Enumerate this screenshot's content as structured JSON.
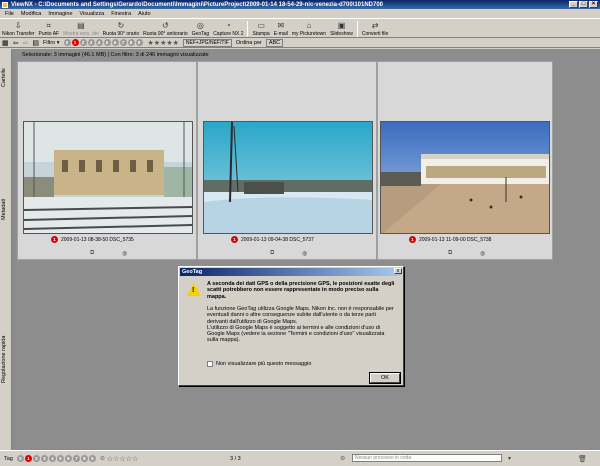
{
  "window": {
    "title": "ViewNX - C:\\Documents and Settings\\Gerardo\\Documenti\\Immagini\\PictureProject\\2009-01-14 18-54-29-nic-venezia-d700\\101ND700"
  },
  "menu": [
    "File",
    "Modifica",
    "Immagine",
    "Visualizza",
    "Finestra",
    "Aiuto"
  ],
  "toolbar": {
    "items": [
      {
        "label": "Nikon Transfer",
        "icon": "transfer-icon",
        "glyph": "⇩"
      },
      {
        "label": "Punto AF",
        "icon": "af-point-icon",
        "glyph": "⌗"
      },
      {
        "label": "Mostra vers. dei",
        "icon": "versions-icon",
        "glyph": "▤",
        "disabled": true
      },
      {
        "label": "Ruota 90° orario",
        "icon": "rotate-cw-icon",
        "glyph": "↻"
      },
      {
        "label": "Ruota 90° antiorario",
        "icon": "rotate-ccw-icon",
        "glyph": "↺"
      },
      {
        "label": "GeoTag",
        "icon": "geotag-icon",
        "glyph": "◎"
      },
      {
        "label": "Capture NX 2",
        "icon": "capture-nx-icon",
        "glyph": "◔"
      },
      {
        "label": "Stampa",
        "icon": "print-icon",
        "glyph": "▭"
      },
      {
        "label": "E-mail",
        "icon": "email-icon",
        "glyph": "✉"
      },
      {
        "label": "my Picturetown",
        "icon": "picturetown-icon",
        "glyph": "⌂"
      },
      {
        "label": "Slideshow",
        "icon": "slideshow-icon",
        "glyph": "▣"
      },
      {
        "label": "Converti file",
        "icon": "convert-icon",
        "glyph": "⇄"
      }
    ]
  },
  "filterbar": {
    "filter_label": "Filtro",
    "label_numbers": [
      "0",
      "1",
      "2",
      "3",
      "4",
      "5",
      "6",
      "7",
      "8",
      "9"
    ],
    "stars": "★★★★★",
    "format_label": "NEF+JPG/NEF/TIF",
    "sort_label": "Ordina per",
    "sort_value": "ABC"
  },
  "sidebar": {
    "tabs": [
      "Cartelle",
      "Metadati",
      "Regolazione rapida"
    ]
  },
  "status": "Selezionate: 3 immagini (46.1 MB) | Con filtro: 3 di 246 immagini visualizzate",
  "thumbnails": [
    {
      "caption": "2009-01-13 08-38-50 DSC_5735"
    },
    {
      "caption": "2009-01-13 09-04-38 DSC_5737"
    },
    {
      "caption": "2009-01-13 11-09-00 DSC_5738"
    }
  ],
  "dialog": {
    "title": "GeoTag",
    "close": "x",
    "warning": "A seconda dei dati GPS o della precisione GPS, le posizioni esatte degli scatti potrebbero non essere rappresentate in modo preciso sulla mappa.",
    "notice": "La funzione GeoTag utilizza Google Maps. Nikon Inc. non è responsabile per eventuali danni o altre conseguenze subite dall'utente o da terze parti derivanti dall'utilizzo di Google Maps.\nL'utilizzo di Google Maps è soggetto ai termini e alle condizioni d'uso di Google Maps (vedere la sezione \"Termini e condizioni d'uso\" visualizzata sulla mappa).",
    "checkbox_label": "Non visualizzare più questo messaggio",
    "ok_label": "OK"
  },
  "bottombar": {
    "tag_label": "Tag",
    "label_numbers": [
      "0",
      "1",
      "2",
      "3",
      "4",
      "5",
      "6",
      "7",
      "8",
      "9"
    ],
    "stars": "☆☆☆☆☆",
    "page": "3 / 3",
    "process_queue": "Nessun processo in coda"
  }
}
